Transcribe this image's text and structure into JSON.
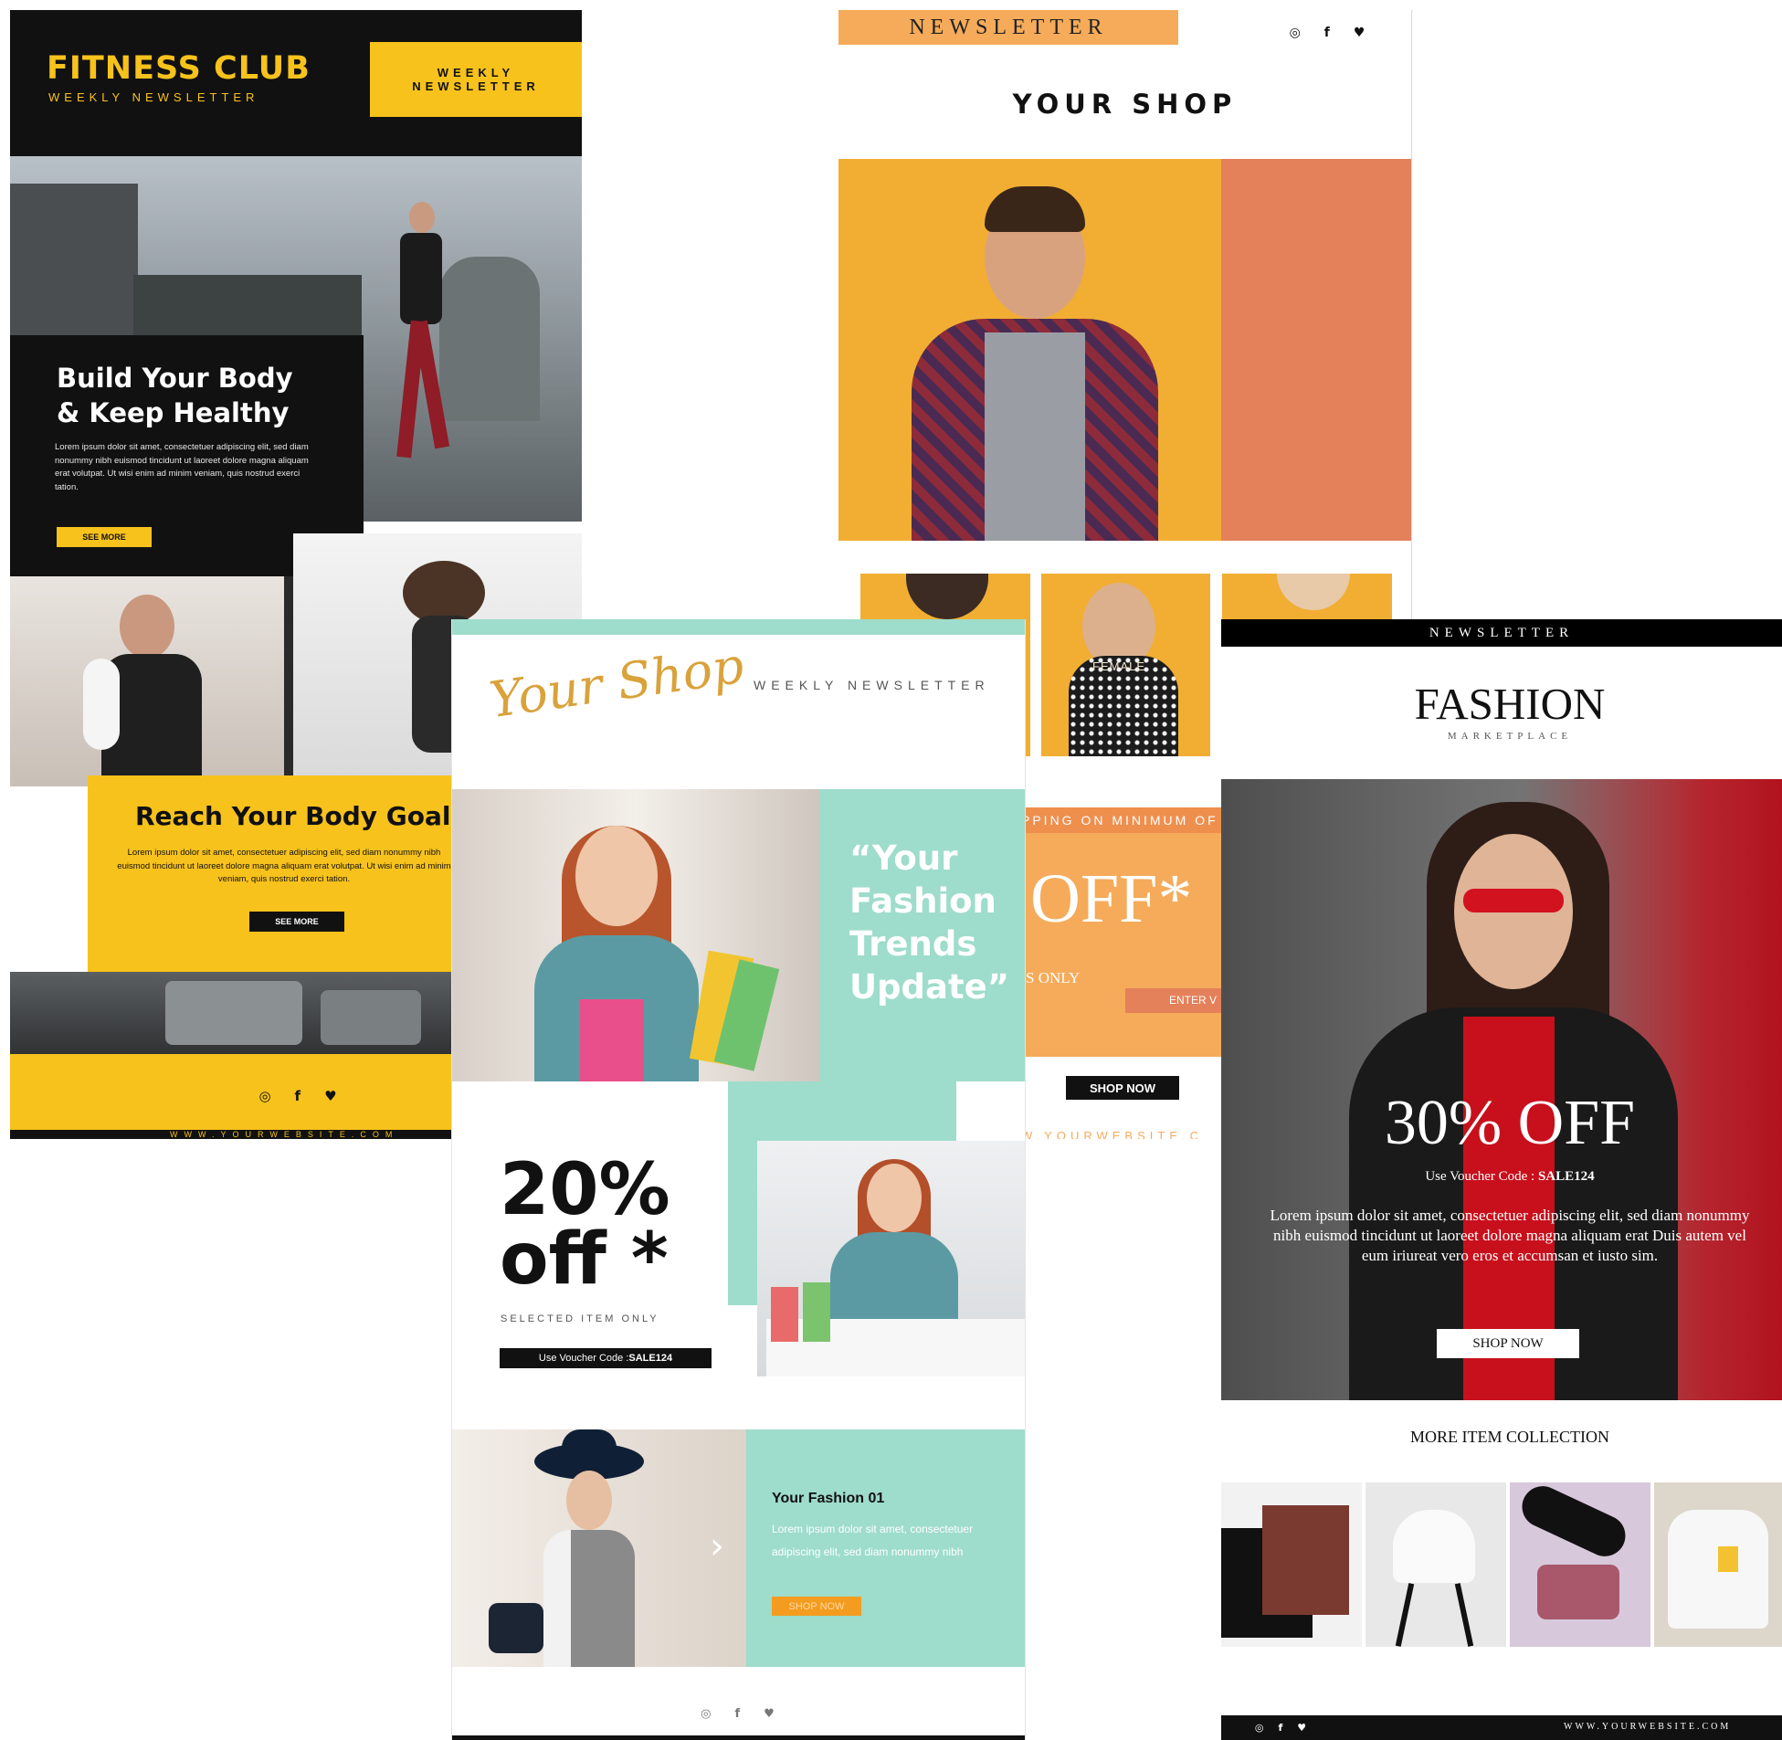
{
  "fitness": {
    "brand": "FITNESS CLUB",
    "brand_sub": "WEEKLY NEWSLETTER",
    "badge_line1": "WEEKLY",
    "badge_line2": "NEWSLETTER",
    "hero_title_1": "Build Your Body",
    "hero_title_2": "& Keep Healthy",
    "hero_text": "Lorem ipsum dolor sit amet, consectetuer adipiscing elit, sed diam nonummy nibh euismod tincidunt ut laoreet dolore magna aliquam erat volutpat. Ut wisi enim ad minim veniam, quis nostrud exerci tation.",
    "see_more": "SEE MORE",
    "goals_title": "Reach Your Body Goals",
    "goals_text": "Lorem ipsum dolor sit amet, consectetuer adipiscing elit, sed diam nonummy nibh euismod tincidunt ut laoreet dolore magna aliquam erat volutpat. Ut wisi enim ad minim veniam, quis nostrud exerci tation.",
    "goals_button": "SEE MORE",
    "website": "WWW.YOURWEBSITE.COM",
    "accent": "#f7c21c"
  },
  "shop": {
    "label": "NEWSLETTER",
    "title": "YOUR SHOP",
    "female_label": "FEMALE",
    "shipping": "PPING ON MINIMUM OF",
    "off": "OFF*",
    "only": "S ONLY",
    "enter": "ENTER V",
    "shop_now": "SHOP NOW",
    "website": "W.YOURWEBSITE.C",
    "accent": "#f5ab5a"
  },
  "teal": {
    "logo": "Your Shop",
    "header_label": "WEEKLY NEWSLETTER",
    "quote_1": "“Your",
    "quote_2": "Fashion",
    "quote_3": "Trends",
    "quote_4": "Update”",
    "discount_1": "20%",
    "discount_2": "off *",
    "selected": "SELECTED ITEM ONLY",
    "voucher_prefix": "Use Voucher Code : ",
    "voucher_code": "SALE124",
    "item_title": "Your Fashion 01",
    "item_text": "Lorem ipsum dolor sit amet, consectetuer adipiscing elit, sed diam nonummy nibh",
    "item_button": "SHOP NOW",
    "accent": "#9edccb"
  },
  "fashion": {
    "label": "NEWSLETTER",
    "brand": "FASHION",
    "brand_sub": "MARKETPLACE",
    "offer": "30% OFF",
    "voucher_prefix": "Use Voucher Code : ",
    "voucher_code": "SALE124",
    "text": "Lorem ipsum dolor sit amet, consectetuer adipiscing elit, sed diam nonummy nibh euismod tincidunt ut laoreet dolore magna aliquam erat Duis autem vel eum iriureat vero eros et accumsan et iusto sim.",
    "shop_now": "SHOP NOW",
    "more": "MORE ITEM COLLECTION",
    "website": "WWW.YOURWEBSITE.COM"
  },
  "social_icons": [
    "instagram-icon",
    "facebook-icon",
    "twitter-icon"
  ]
}
